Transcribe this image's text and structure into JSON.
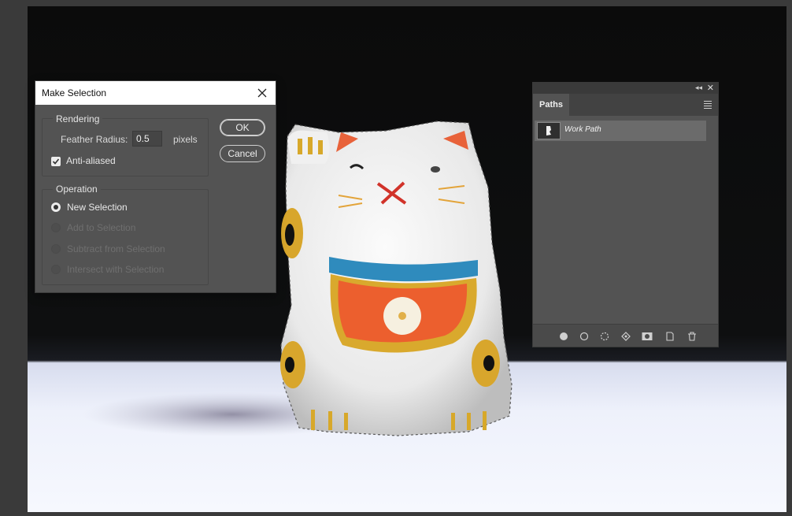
{
  "dialog": {
    "title": "Make Selection",
    "rendering_label": "Rendering",
    "feather_label": "Feather Radius:",
    "feather_value": "0.5",
    "feather_unit": "pixels",
    "antialias_label": "Anti-aliased",
    "antialias_checked": true,
    "operation_label": "Operation",
    "operations": [
      {
        "label": "New Selection",
        "selected": true,
        "enabled": true
      },
      {
        "label": "Add to Selection",
        "selected": false,
        "enabled": false
      },
      {
        "label": "Subtract from Selection",
        "selected": false,
        "enabled": false
      },
      {
        "label": "Intersect with Selection",
        "selected": false,
        "enabled": false
      }
    ],
    "ok_label": "OK",
    "cancel_label": "Cancel"
  },
  "panel": {
    "tab_label": "Paths",
    "collapse_glyph": "◂◂",
    "close_glyph": "✕",
    "paths": [
      {
        "name": "Work Path"
      }
    ],
    "footer_icons": [
      "fill-path-icon",
      "stroke-path-icon",
      "load-as-selection-icon",
      "make-work-path-icon",
      "add-mask-icon",
      "new-path-icon",
      "delete-path-icon"
    ]
  },
  "colors": {
    "panel_bg": "#535353",
    "dialog_title_bg": "#ffffff",
    "canvas_bg": "#0b0b0b",
    "table_surface": "#eef1fb"
  }
}
